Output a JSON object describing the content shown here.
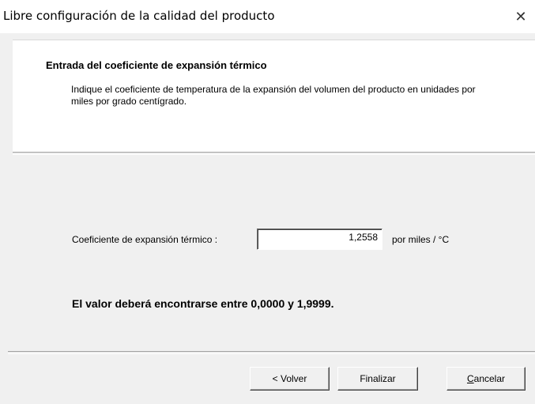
{
  "window": {
    "title": "Libre configuración de la calidad del producto",
    "close_glyph": "✕"
  },
  "header": {
    "title": "Entrada del coeficiente de expansión térmico",
    "description": "Indique el coeficiente de temperatura de la expansión del volumen del producto en unidades por miles por grado centígrado."
  },
  "form": {
    "coef_label": "Coeficiente de expansión térmico :",
    "coef_value": "1,2558",
    "unit_label": "por miles / °C",
    "range_message": "El valor deberá encontrarse entre 0,0000 y 1,9999."
  },
  "buttons": {
    "back_label": "< Volver",
    "finish_label": "Finalizar",
    "cancel_first_letter": "C",
    "cancel_rest": "ancelar"
  }
}
